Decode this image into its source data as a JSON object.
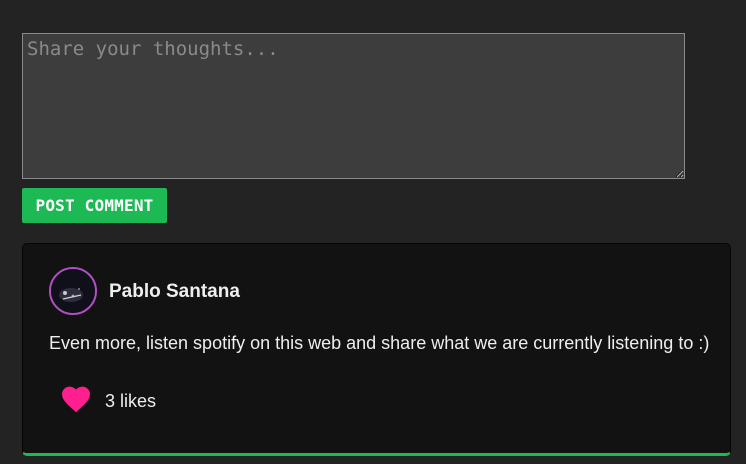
{
  "comment_form": {
    "placeholder": "Share your thoughts...",
    "value": "",
    "submit_label": "POST COMMENT"
  },
  "comments": [
    {
      "author": "Pablo Santana",
      "text": "Even more, listen spotify on this web and share what we are currently listening to :)",
      "likes_text": "3 likes",
      "likes": 3
    }
  ],
  "colors": {
    "accent": "#1db954",
    "like": "#ff1f8e",
    "avatar_ring": "#b24fc4"
  },
  "icons": {
    "like": "heart-icon"
  }
}
